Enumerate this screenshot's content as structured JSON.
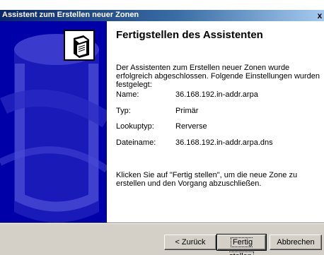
{
  "window": {
    "title": "Assistent zum Erstellen neuer Zonen",
    "close_symbol": "x"
  },
  "content": {
    "heading": "Fertigstellen des Assistenten",
    "intro": "Der Assistenten zum Erstellen neuer Zonen wurde erfolgreich abgeschlossen. Folgende Einstellungen wurden festgelegt:",
    "settings": [
      {
        "label": "Name:",
        "value": "36.168.192.in-addr.arpa"
      },
      {
        "label": "Typ:",
        "value": "Primär"
      },
      {
        "label": "Lookuptyp:",
        "value": "Rerverse"
      },
      {
        "label": "Dateiname:",
        "value": "36.168.192.in-addr.arpa.dns"
      }
    ],
    "hint": "Klicken Sie auf \"Fertig stellen\", um die neue Zone zu erstellen und den Vorgang abzuschließen."
  },
  "buttons": {
    "back": "< Zurück",
    "finish": "Fertig stellen",
    "cancel": "Abbrechen"
  },
  "icons": {
    "wizard_icon": "server-icon",
    "side_graphic": "wizard-banner-graphic"
  },
  "colors": {
    "side_panel": "#0000a8",
    "title_start": "#0a246a",
    "title_end": "#a6caf0",
    "button_face": "#d4d0c8"
  }
}
